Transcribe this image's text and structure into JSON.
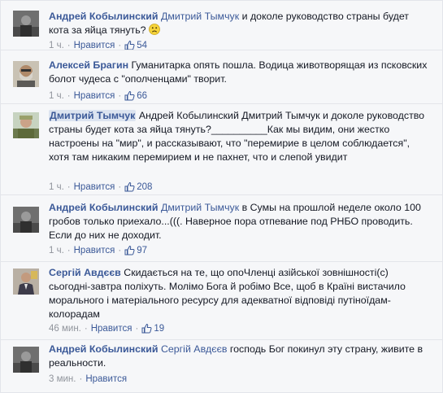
{
  "comments": [
    {
      "author": "Андрей Кобылинский",
      "tag": "Дмитрий Тымчук",
      "text": " и доколе руководство страны будет кота за яйца тянуть? ",
      "emoji": "frown-emoji",
      "time": "1 ч.",
      "like_label": "Нравится",
      "likes": "54"
    },
    {
      "author": "Алексей Брагин",
      "tag": "",
      "text": " Гуманитарка опять пошла. Водица животворящая из псковских болот чудеса с \"ополченцами\" творит.",
      "time": "1 ч.",
      "like_label": "Нравится",
      "likes": "66"
    },
    {
      "author": "Дмитрий Тымчук",
      "tag": "",
      "text": " Андрей Кобылинский Дмитрий Тымчук и доколе руководство страны будет кота за яйца тянуть?__________Как мы видим, они жестко настроены на \"мир\", и рассказывают, что \"перемирие в целом соблюдается\", хотя там никаким перемирием и не пахнет, что и слепой увидит",
      "time": "1 ч.",
      "like_label": "Нравится",
      "likes": "208"
    },
    {
      "author": "Андрей Кобылинский",
      "tag": "Дмитрий Тымчук",
      "text": " в Сумы на прошлой неделе около 100 гробов только приехало...(((. Наверное пора отпевание под РНБО проводить. Если до них не доходит.",
      "time": "1 ч.",
      "like_label": "Нравится",
      "likes": "97"
    },
    {
      "author": "Сергій Авдєєв",
      "tag": "",
      "text": " Скидається на те, що опоЧленці азійської зовнішності(с) сьогодні-завтра поліхуть. Молімо Бога й робімо Все, щоб в Країні вистачило морального і матеріального ресурсу для адекватної відповіді путіноїдам-колорадам",
      "time": "46 мин.",
      "like_label": "Нравится",
      "likes": "19"
    },
    {
      "author": "Андрей Кобылинский",
      "tag": "Сергій Авдєєв",
      "text": " господь Бог покинул эту страну, живите в реальности.",
      "time": "3 мин.",
      "like_label": "Нравится",
      "likes": ""
    }
  ],
  "colors": {
    "link": "#3b5998",
    "meta": "#90949c",
    "background": "#f6f7f9",
    "divider": "#e3e5ea"
  },
  "icons": {
    "like": "thumbs-up-icon",
    "emoji": "frown-emoji"
  }
}
